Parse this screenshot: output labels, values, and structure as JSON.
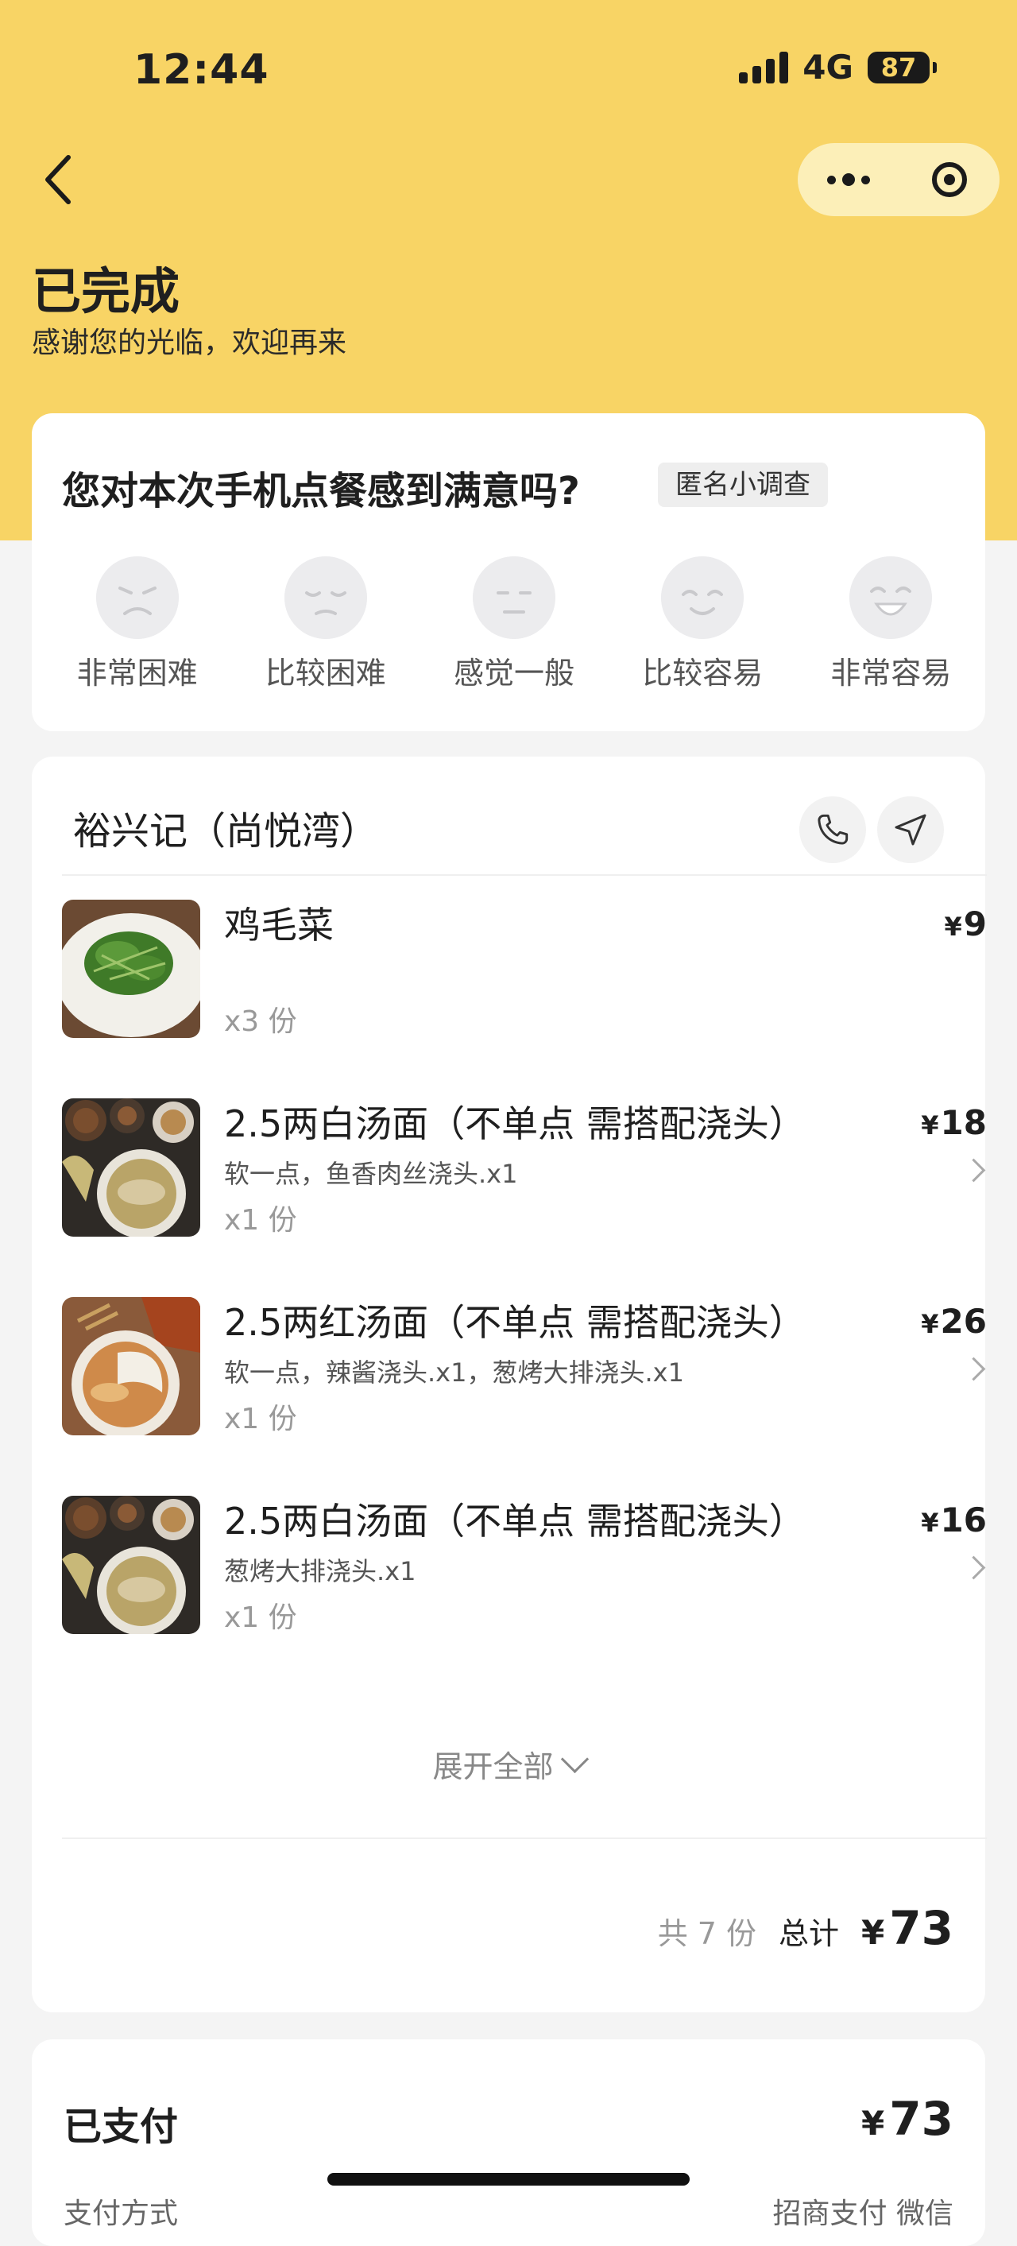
{
  "status_bar": {
    "time": "12:44",
    "network": "4G",
    "battery": "87"
  },
  "header": {
    "title": "已完成",
    "subtitle": "感谢您的光临，欢迎再来"
  },
  "survey": {
    "question": "您对本次手机点餐感到满意吗?",
    "tag": "匿名小调查",
    "options": [
      "非常困难",
      "比较困难",
      "感觉一般",
      "比较容易",
      "非常容易"
    ]
  },
  "order": {
    "shop_name": "裕兴记（尚悦湾）",
    "items": [
      {
        "name": "鸡毛菜",
        "spec": "",
        "qty": "x3 份",
        "currency": "¥",
        "price": "9"
      },
      {
        "name": "2.5两白汤面（不单点 需搭配浇头）",
        "spec": "软一点，鱼香肉丝浇头.x1",
        "qty": "x1 份",
        "currency": "¥",
        "price": "18"
      },
      {
        "name": "2.5两红汤面（不单点 需搭配浇头）",
        "spec": "软一点，辣酱浇头.x1，葱烤大排浇头.x1",
        "qty": "x1 份",
        "currency": "¥",
        "price": "26"
      },
      {
        "name": "2.5两白汤面（不单点 需搭配浇头）",
        "spec": "葱烤大排浇头.x1",
        "qty": "x1 份",
        "currency": "¥",
        "price": "16"
      }
    ],
    "expand_label": "展开全部",
    "total_count": "共 7 份",
    "total_label": "总计",
    "total_currency": "¥",
    "total_amount": "73"
  },
  "payment": {
    "status": "已支付",
    "currency": "¥",
    "amount": "73",
    "method_label": "支付方式",
    "method_value": "招商支付 微信"
  },
  "colors": {
    "accent": "#f8d465",
    "background": "#f4f4f4"
  }
}
